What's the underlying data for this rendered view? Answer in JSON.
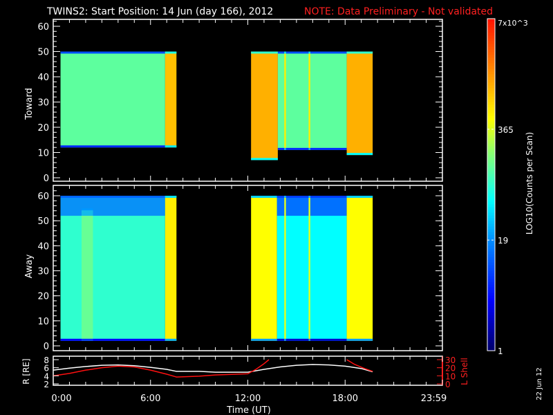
{
  "title": {
    "main": "TWINS2: Start Position: 14 Jun (day 166), 2012",
    "note": "NOTE: Data Preliminary - Not validated",
    "note_color": "#ff2020"
  },
  "footer_date": "22 Jun 12",
  "chart_data": [
    {
      "type": "heatmap",
      "name": "Toward",
      "ylabel": "Toward",
      "ylim": [
        0,
        62
      ],
      "yticks": [
        "0",
        "10",
        "20",
        "30",
        "40",
        "50",
        "60"
      ],
      "xlim_hours": [
        0,
        24
      ],
      "segments": [
        {
          "t0": 0.45,
          "t1": 6.9,
          "e0": 12,
          "e1": 50,
          "level": 0.55
        },
        {
          "t0": 6.9,
          "t1": 7.6,
          "e0": 12,
          "e1": 50,
          "level": 0.78
        },
        {
          "t0": 12.2,
          "t1": 13.85,
          "e0": 7,
          "e1": 50,
          "level": 0.8
        },
        {
          "t0": 13.85,
          "t1": 18.1,
          "e0": 11,
          "e1": 50,
          "level": 0.55
        },
        {
          "t0": 14.25,
          "t1": 14.35,
          "e0": 11,
          "e1": 50,
          "level": 0.72
        },
        {
          "t0": 15.75,
          "t1": 15.85,
          "e0": 11,
          "e1": 50,
          "level": 0.72
        },
        {
          "t0": 18.1,
          "t1": 19.7,
          "e0": 9,
          "e1": 50,
          "level": 0.8
        }
      ]
    },
    {
      "type": "heatmap",
      "name": "Away",
      "ylabel": "Away",
      "ylim": [
        0,
        62
      ],
      "yticks": [
        "0",
        "10",
        "20",
        "30",
        "40",
        "50",
        "60"
      ],
      "xlim_hours": [
        0,
        24
      ],
      "segments": [
        {
          "t0": 0.45,
          "t1": 6.9,
          "e0": 2,
          "e1": 60,
          "level": 0.5
        },
        {
          "t0": 1.75,
          "t1": 2.45,
          "e0": 2,
          "e1": 55,
          "level": 0.56
        },
        {
          "t0": 6.9,
          "t1": 7.6,
          "e0": 2,
          "e1": 60,
          "level": 0.72
        },
        {
          "t0": 12.2,
          "t1": 13.8,
          "e0": 2,
          "e1": 60,
          "level": 0.7
        },
        {
          "t0": 13.8,
          "t1": 18.1,
          "e0": 2,
          "e1": 60,
          "level": 0.45
        },
        {
          "t0": 14.25,
          "t1": 14.35,
          "e0": 2,
          "e1": 60,
          "level": 0.68
        },
        {
          "t0": 15.75,
          "t1": 15.85,
          "e0": 2,
          "e1": 60,
          "level": 0.68
        },
        {
          "t0": 18.1,
          "t1": 19.7,
          "e0": 2,
          "e1": 60,
          "level": 0.7
        }
      ]
    },
    {
      "type": "line",
      "name": "Orbit",
      "ylabel_left": "R [RE]",
      "ylabel_right": "L Shell",
      "ylim_left": [
        2,
        8
      ],
      "ylim_right": [
        0,
        30
      ],
      "yticks_left": [
        "2",
        "4",
        "6",
        "8"
      ],
      "yticks_right": [
        "0",
        "10",
        "20",
        "30"
      ],
      "xlabel": "Time (UT)",
      "xticks": [
        "0:00",
        "6:00",
        "12:00",
        "18:00",
        "23:59"
      ],
      "xtick_hours": [
        0,
        6,
        12,
        18,
        23.98
      ],
      "series": [
        {
          "name": "R",
          "color": "#ffffff",
          "axis": "left",
          "x": [
            0,
            1,
            2,
            3,
            4,
            5,
            6,
            7,
            7.6,
            9,
            10,
            12,
            13,
            14,
            15,
            16,
            17,
            18,
            19,
            19.7
          ],
          "y": [
            5.4,
            5.9,
            6.3,
            6.6,
            6.7,
            6.5,
            6.1,
            5.6,
            5.1,
            5.1,
            4.9,
            4.9,
            5.6,
            6.2,
            6.6,
            6.8,
            6.7,
            6.4,
            5.8,
            5.0
          ]
        },
        {
          "name": "L Shell",
          "color": "#ff1010",
          "axis": "right",
          "x": [
            0,
            1,
            2,
            3,
            4,
            5,
            6,
            7,
            7.6,
            9,
            10,
            12,
            12.5,
            13,
            13.3
          ],
          "y": [
            10,
            13,
            17,
            20,
            22,
            21,
            17,
            12,
            8.5,
            9.5,
            11,
            12.5,
            18,
            25,
            30
          ]
        },
        {
          "name": "L Shell (late)",
          "color": "#ff1010",
          "axis": "right",
          "x": [
            18.1,
            18.6,
            19.2,
            19.7
          ],
          "y": [
            30,
            24,
            19,
            15.5
          ]
        }
      ]
    },
    {
      "type": "colorbar",
      "label": "LOG10(Counts per Scan)",
      "ticks": [
        "1",
        "19",
        "365",
        "7x10^3"
      ],
      "tick_levels": [
        0,
        0.333,
        0.667,
        1
      ]
    }
  ]
}
